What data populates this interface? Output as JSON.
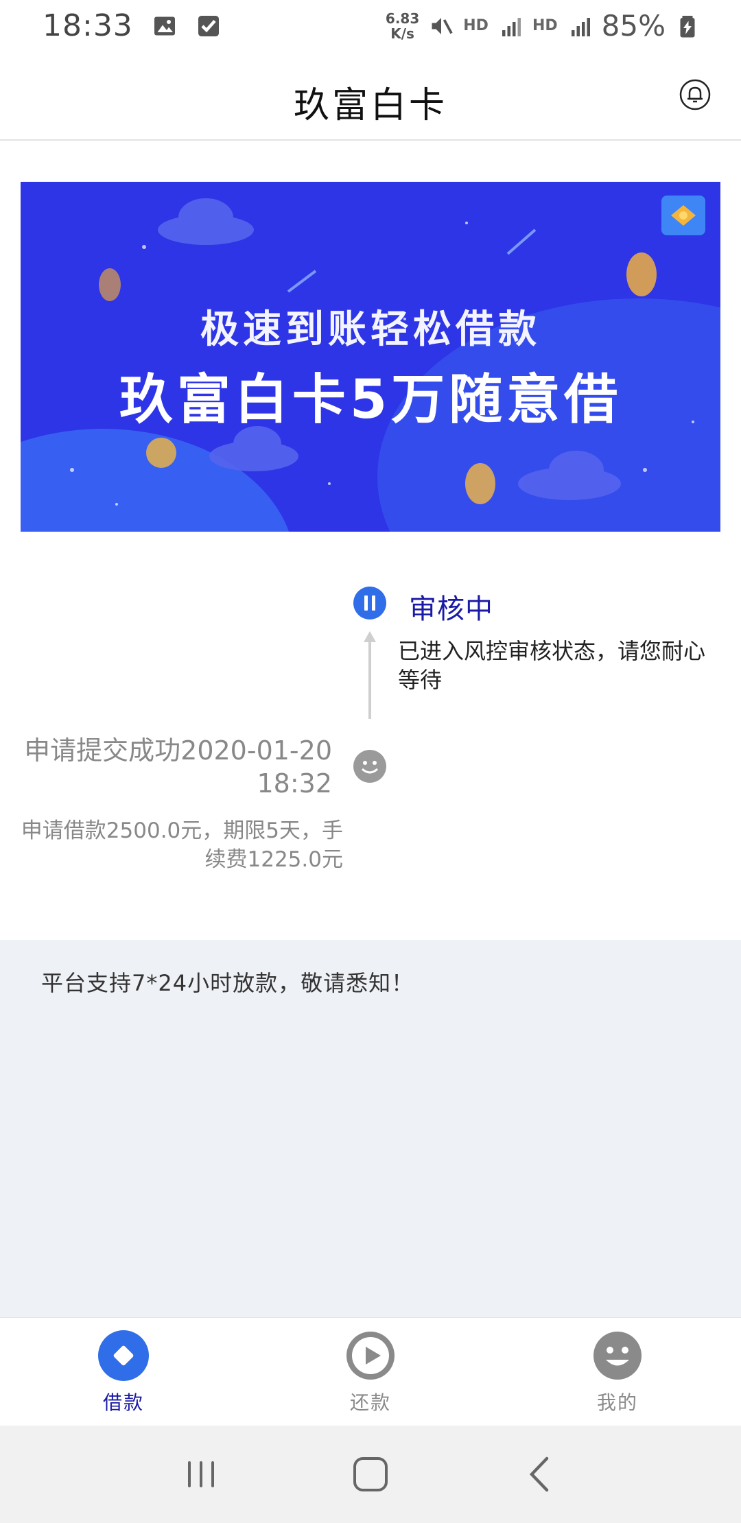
{
  "status_bar": {
    "time": "18:33",
    "net_speed_value": "6.83",
    "net_speed_unit": "K/s",
    "hd1": "HD",
    "hd2": "HD",
    "battery": "85%"
  },
  "header": {
    "title": "玖富白卡"
  },
  "banner": {
    "line1": "极速到账轻松借款",
    "line2": "玖富白卡5万随意借"
  },
  "timeline": {
    "status_title": "审核中",
    "status_desc": "已进入风控审核状态，请您耐心等待",
    "submit_title": "申请提交成功2020-01-20 18:32",
    "submit_desc": "申请借款2500.0元，期限5天，手续费1225.0元"
  },
  "notice": {
    "text": "平台支持7*24小时放款，敬请悉知！"
  },
  "bottom_nav": {
    "items": [
      {
        "label": "借款",
        "active": true
      },
      {
        "label": "还款",
        "active": false
      },
      {
        "label": "我的",
        "active": false
      }
    ]
  },
  "colors": {
    "accent": "#2f6ee8",
    "active_label": "#1a1aa6",
    "banner_bg": "#2d35e6",
    "inactive_icon": "#8a8a8a",
    "notice_bg": "#eef1f5"
  }
}
